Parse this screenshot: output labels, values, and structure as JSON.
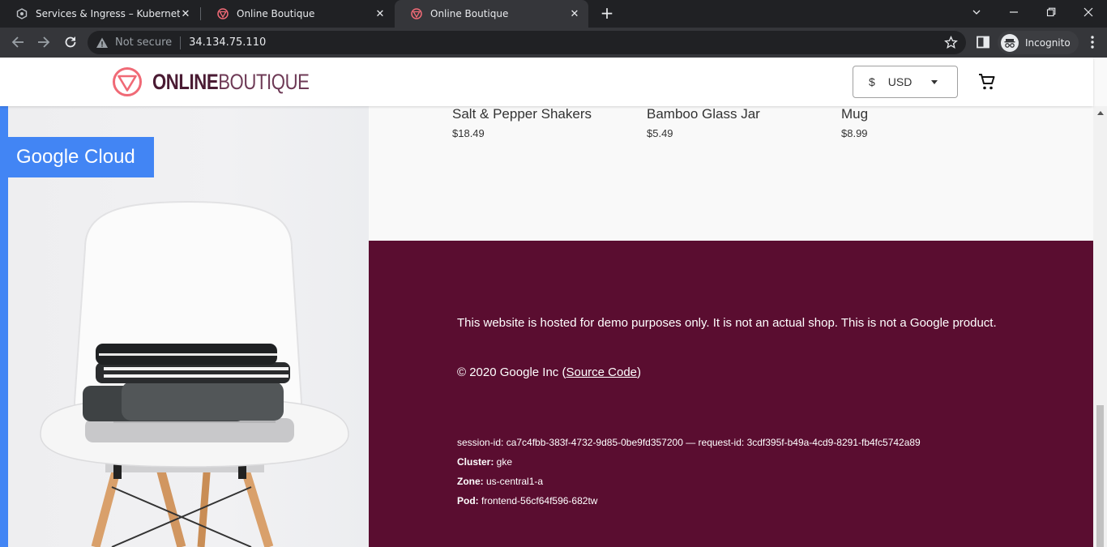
{
  "browser": {
    "tabs": [
      {
        "title": "Services & Ingress – Kubernetes E",
        "icon": "gke-icon",
        "active": false
      },
      {
        "title": "Online Boutique",
        "icon": "boutique-icon",
        "active": false
      },
      {
        "title": "Online Boutique",
        "icon": "boutique-icon",
        "active": true
      }
    ],
    "address": {
      "security": "Not secure",
      "url": "34.134.75.110"
    },
    "profile_label": "Incognito"
  },
  "header": {
    "logo_bold": "ONLINE",
    "logo_light": "BOUTIQUE",
    "currency_symbol": "$",
    "currency_code": "USD"
  },
  "hero": {
    "badge": "Google Cloud"
  },
  "products": [
    {
      "name": "Salt & Pepper Shakers",
      "price": "$18.49"
    },
    {
      "name": "Bamboo Glass Jar",
      "price": "$5.49"
    },
    {
      "name": "Mug",
      "price": "$8.99"
    }
  ],
  "footer": {
    "disclaimer": "This website is hosted for demo purposes only. It is not an actual shop. This is not a Google product.",
    "copyright_prefix": "© 2020 Google Inc (",
    "source_link": "Source Code",
    "copyright_suffix": ")",
    "session_line": "session-id: ca7c4fbb-383f-4732-9d85-0be9fd357200 — request-id: 3cdf395f-b49a-4cd9-8291-fb4fc5742a89",
    "cluster_label": "Cluster:",
    "cluster_value": " gke",
    "zone_label": "Zone:",
    "zone_value": " us-central1-a",
    "pod_label": "Pod:",
    "pod_value": " frontend-56cf64f596-682tw"
  },
  "colors": {
    "brand": "#5a0d30",
    "accent": "#4285f4",
    "logo": "#f06a76"
  }
}
